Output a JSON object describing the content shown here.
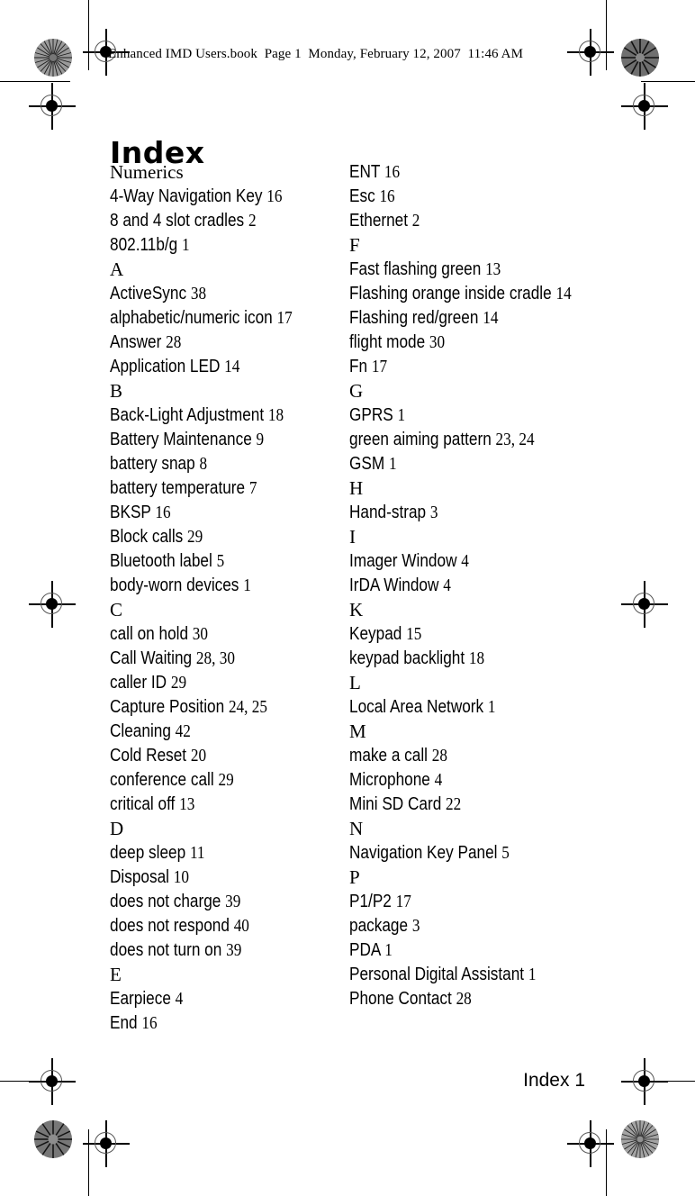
{
  "header": {
    "text": "Enhanced IMD Users.book  Page 1  Monday, February 12, 2007  11:46 AM"
  },
  "title": "Index",
  "footer": "Index 1",
  "columns": {
    "left": [
      {
        "type": "letter",
        "label": "Numerics"
      },
      {
        "type": "entry",
        "term": "4-Way Navigation Key",
        "pages": "16"
      },
      {
        "type": "entry",
        "term": "8 and 4 slot cradles",
        "pages": "2"
      },
      {
        "type": "entry",
        "term": "802.11b/g",
        "pages": "1"
      },
      {
        "type": "letter",
        "label": "A"
      },
      {
        "type": "entry",
        "term": "ActiveSync",
        "pages": "38"
      },
      {
        "type": "entry",
        "term": "alphabetic/numeric icon",
        "pages": "17"
      },
      {
        "type": "entry",
        "term": "Answer",
        "pages": "28"
      },
      {
        "type": "entry",
        "term": "Application LED",
        "pages": "14"
      },
      {
        "type": "letter",
        "label": "B"
      },
      {
        "type": "entry",
        "term": "Back-Light Adjustment",
        "pages": "18"
      },
      {
        "type": "entry",
        "term": "Battery Maintenance",
        "pages": "9"
      },
      {
        "type": "entry",
        "term": "battery snap",
        "pages": "8"
      },
      {
        "type": "entry",
        "term": "battery temperature",
        "pages": "7"
      },
      {
        "type": "entry",
        "term": "BKSP",
        "pages": "16"
      },
      {
        "type": "entry",
        "term": "Block calls",
        "pages": "29"
      },
      {
        "type": "entry",
        "term": "Bluetooth label",
        "pages": "5"
      },
      {
        "type": "entry",
        "term": "body-worn devices",
        "pages": "1"
      },
      {
        "type": "letter",
        "label": "C"
      },
      {
        "type": "entry",
        "term": "call on hold",
        "pages": "30"
      },
      {
        "type": "entry",
        "term": "Call Waiting",
        "pages": "28, 30"
      },
      {
        "type": "entry",
        "term": "caller ID",
        "pages": "29"
      },
      {
        "type": "entry",
        "term": "Capture Position",
        "pages": "24, 25"
      },
      {
        "type": "entry",
        "term": "Cleaning",
        "pages": "42"
      },
      {
        "type": "entry",
        "term": "Cold Reset",
        "pages": "20"
      },
      {
        "type": "entry",
        "term": "conference call",
        "pages": "29"
      },
      {
        "type": "entry",
        "term": "critical off",
        "pages": "13"
      },
      {
        "type": "letter",
        "label": "D"
      },
      {
        "type": "entry",
        "term": "deep sleep",
        "pages": "11"
      },
      {
        "type": "entry",
        "term": "Disposal",
        "pages": "10"
      },
      {
        "type": "entry",
        "term": "does not charge",
        "pages": "39"
      },
      {
        "type": "entry",
        "term": "does not respond",
        "pages": "40"
      },
      {
        "type": "entry",
        "term": "does not turn on",
        "pages": "39"
      },
      {
        "type": "letter",
        "label": "E"
      },
      {
        "type": "entry",
        "term": "Earpiece",
        "pages": "4"
      },
      {
        "type": "entry",
        "term": "End",
        "pages": "16"
      }
    ],
    "right": [
      {
        "type": "entry",
        "term": "ENT",
        "pages": "16"
      },
      {
        "type": "entry",
        "term": "Esc",
        "pages": "16"
      },
      {
        "type": "entry",
        "term": "Ethernet",
        "pages": "2"
      },
      {
        "type": "letter",
        "label": "F"
      },
      {
        "type": "entry",
        "term": "Fast flashing green",
        "pages": "13"
      },
      {
        "type": "entry",
        "term": "Flashing orange inside cradle",
        "pages": "14"
      },
      {
        "type": "entry",
        "term": "Flashing red/green",
        "pages": "14"
      },
      {
        "type": "entry",
        "term": "flight mode",
        "pages": "30"
      },
      {
        "type": "entry",
        "term": "Fn",
        "pages": "17"
      },
      {
        "type": "letter",
        "label": "G"
      },
      {
        "type": "entry",
        "term": "GPRS",
        "pages": "1"
      },
      {
        "type": "entry",
        "term": "green aiming pattern",
        "pages": "23, 24"
      },
      {
        "type": "entry",
        "term": "GSM",
        "pages": "1"
      },
      {
        "type": "letter",
        "label": "H"
      },
      {
        "type": "entry",
        "term": "Hand-strap",
        "pages": "3"
      },
      {
        "type": "letter",
        "label": "I"
      },
      {
        "type": "entry",
        "term": "Imager Window",
        "pages": "4"
      },
      {
        "type": "entry",
        "term": "IrDA Window",
        "pages": "4"
      },
      {
        "type": "letter",
        "label": "K"
      },
      {
        "type": "entry",
        "term": "Keypad",
        "pages": "15"
      },
      {
        "type": "entry",
        "term": "keypad backlight",
        "pages": "18"
      },
      {
        "type": "letter",
        "label": "L"
      },
      {
        "type": "entry",
        "term": "Local Area Network",
        "pages": "1"
      },
      {
        "type": "letter",
        "label": "M"
      },
      {
        "type": "entry",
        "term": "make a call",
        "pages": "28"
      },
      {
        "type": "entry",
        "term": "Microphone",
        "pages": "4"
      },
      {
        "type": "entry",
        "term": "Mini SD Card",
        "pages": "22"
      },
      {
        "type": "letter",
        "label": "N"
      },
      {
        "type": "entry",
        "term": "Navigation Key Panel",
        "pages": "5"
      },
      {
        "type": "letter",
        "label": "P"
      },
      {
        "type": "entry",
        "term": "P1/P2",
        "pages": "17"
      },
      {
        "type": "entry",
        "term": "package",
        "pages": "3"
      },
      {
        "type": "entry",
        "term": "PDA",
        "pages": "1"
      },
      {
        "type": "entry",
        "term": "Personal Digital Assistant",
        "pages": "1"
      },
      {
        "type": "entry",
        "term": "Phone Contact",
        "pages": "28"
      }
    ]
  }
}
